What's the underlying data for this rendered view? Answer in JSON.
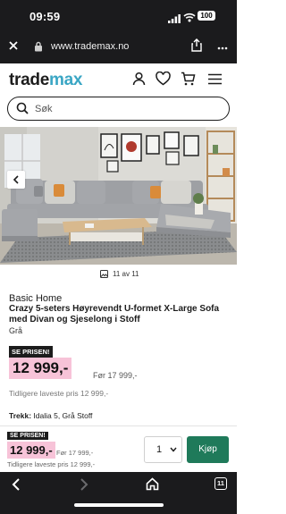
{
  "status_bar": {
    "time": "09:59",
    "battery": "100"
  },
  "browser": {
    "url": "www.trademax.no"
  },
  "site": {
    "logo_part1": "trade",
    "logo_part2": "max",
    "search_placeholder": "Søk",
    "accent_color": "#3aa6c4"
  },
  "gallery": {
    "counter": "11 av 11"
  },
  "product": {
    "brand": "Basic Home",
    "title": "Crazy 5-seters Høyrevendt U-formet X-Large Sofa med Divan og Sjeselong i Stoff",
    "color": "Grå",
    "badge": "SE PRISEN!",
    "price": "12 999,-",
    "before_price": "Før 17 999,-",
    "lowest_price": "Tidligere laveste pris 12 999,-",
    "spec_label": "Trekk:",
    "spec_value": "Idalia 5, Grå Stoff",
    "price_highlight_color": "#f7c3d8"
  },
  "buy_bar": {
    "badge": "SE PRISEN!",
    "price": "12 999,-",
    "before_price": "Før 17 999,-",
    "lowest_price": "Tidligere laveste pris 12 999,-",
    "quantity": "1",
    "buy_label": "Kjøp",
    "buy_color": "#1f7a5a"
  },
  "toolbar": {
    "tabs_count": "11"
  }
}
